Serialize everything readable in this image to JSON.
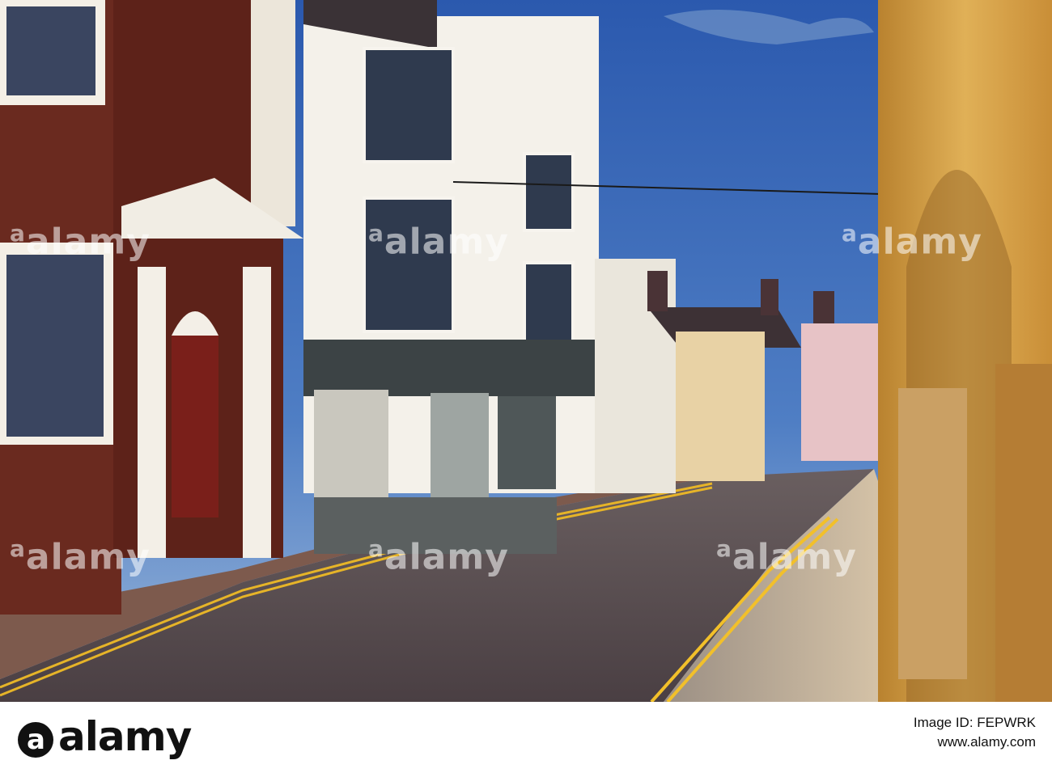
{
  "watermark": {
    "text": "alamy",
    "brand_icon": "alamy-a-logo-icon"
  },
  "footer": {
    "logo_text": "alamy",
    "image_id_label": "Image ID: FEPWRK",
    "url": "www.alamy.com"
  },
  "colors": {
    "sky_top": "#2f5fb0",
    "sky_bottom": "#8fb0d8",
    "road": "#5a5052",
    "road_lines": "#f2c02a",
    "brick_left": "#6a2a1f",
    "stucco": "#f4f1ea",
    "stone_arch": "#d7a44c",
    "pink_house": "#e7c3c6",
    "footer_bg": "#ffffff",
    "footer_text": "#111111"
  }
}
